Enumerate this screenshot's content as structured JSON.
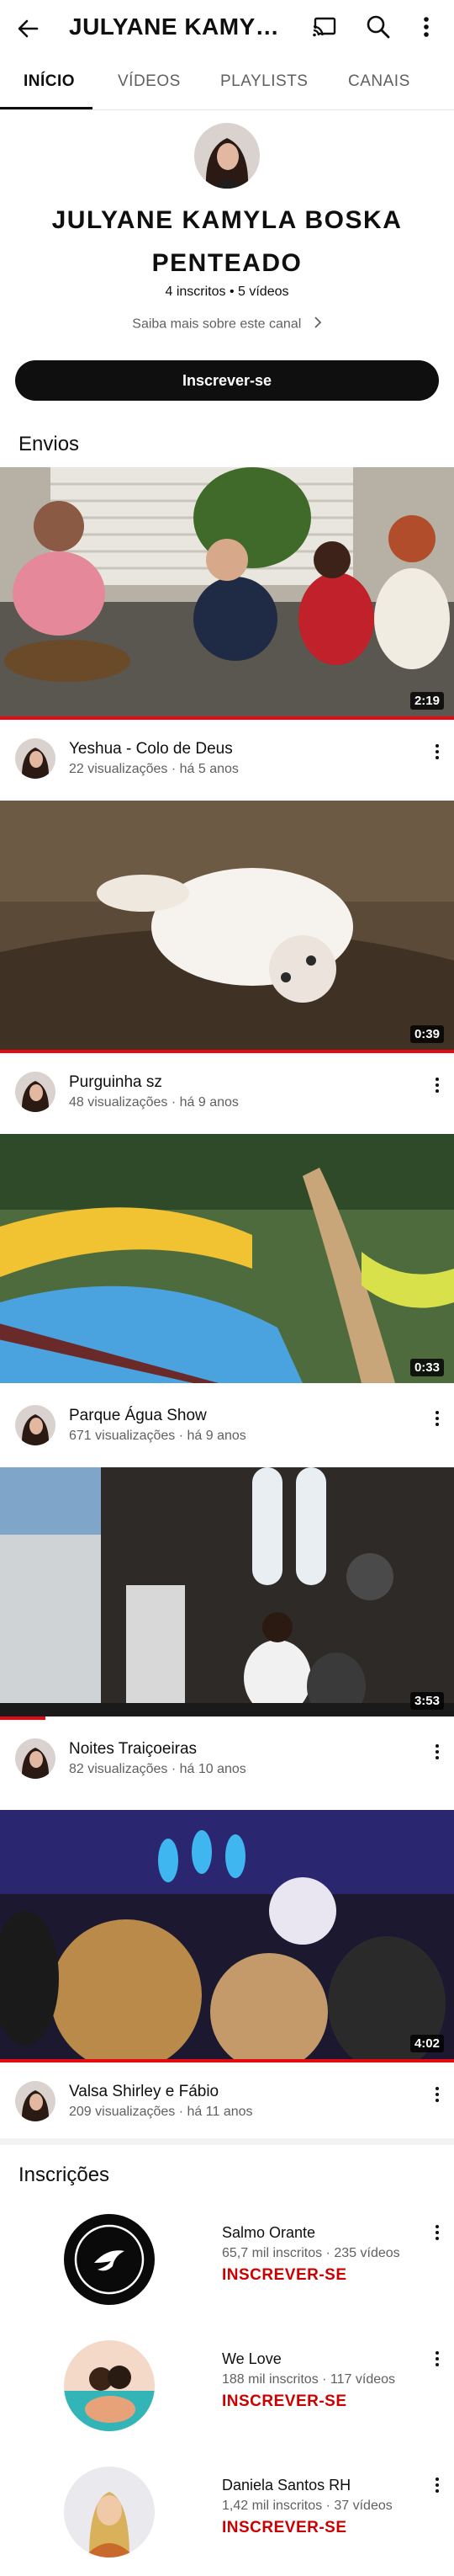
{
  "header": {
    "title": "JULYANE KAMYLA BOSKA PENTEADO",
    "icons": [
      "back-arrow-icon",
      "cast-icon",
      "search-icon",
      "more-vert-icon"
    ]
  },
  "tabs": [
    {
      "label": "INÍCIO",
      "active": true
    },
    {
      "label": "VÍDEOS",
      "active": false
    },
    {
      "label": "PLAYLISTS",
      "active": false
    },
    {
      "label": "CANAIS",
      "active": false
    }
  ],
  "channel": {
    "name": "JULYANE KAMYLA BOSKA PENTEADO",
    "meta": "4 inscritos • 5 vídeos",
    "about": "Saiba mais sobre este canal",
    "subscribe": "Inscrever-se"
  },
  "uploads": {
    "title": "Envios",
    "videos": [
      {
        "title": "Yeshua - Colo de Deus",
        "meta": "22 visualizações · há 5 anos",
        "duration": "2:19",
        "progress": 1.0
      },
      {
        "title": "Purguinha sz",
        "meta": "48 visualizações · há 9 anos",
        "duration": "0:39",
        "progress": 1.0
      },
      {
        "title": "Parque Água Show",
        "meta": "671 visualizações · há 9 anos",
        "duration": "0:33",
        "progress": 0.0
      },
      {
        "title": "Noites Traiçoeiras",
        "meta": "82 visualizações · há 10 anos",
        "duration": "3:53",
        "progress": 0.1
      },
      {
        "title": "Valsa Shirley e Fábio",
        "meta": "209 visualizações · há 11 anos",
        "duration": "4:02",
        "progress": 1.0
      }
    ]
  },
  "subscriptions": {
    "title": "Inscrições",
    "channels": [
      {
        "name": "Salmo Orante",
        "meta": "65,7 mil inscritos · 235 vídeos",
        "action": "INSCREVER-SE"
      },
      {
        "name": "We Love",
        "meta": "188 mil inscritos · 117 vídeos",
        "action": "INSCREVER-SE"
      },
      {
        "name": "Daniela Santos RH",
        "meta": "1,42 mil inscritos · 37 vídeos",
        "action": "INSCREVER-SE"
      }
    ]
  },
  "colors": {
    "progress": "#e50914",
    "subscribe_action": "#cc0000",
    "button_bg": "#0f0f0f"
  }
}
